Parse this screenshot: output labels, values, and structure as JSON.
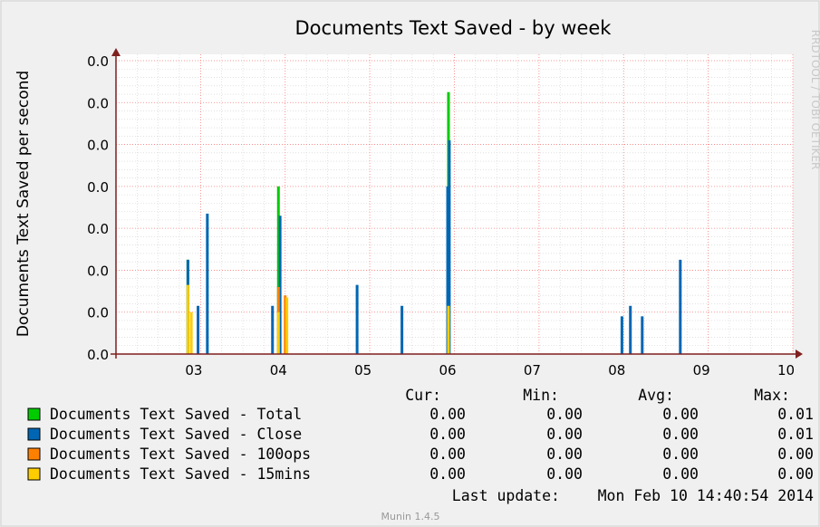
{
  "watermark": "RRDTOOL / TOBI OETIKER",
  "footer": "Munin 1.4.5",
  "colors": {
    "total": "#00cc00",
    "close": "#0066b3",
    "100ops": "#ff8000",
    "15mins": "#ffcc00",
    "grid_major": "#ff8080",
    "grid_minor": "#cfcfcf",
    "axis": "#7f1f1f",
    "canvas": "#ffffff",
    "background": "#f0f0f0"
  },
  "chart_data": {
    "type": "bar",
    "title": "Documents Text Saved - by week",
    "ylabel": "Documents Text Saved per second",
    "xlabel": "",
    "ylim": [
      0,
      0.014
    ],
    "y_tick_values": [
      0,
      0.002,
      0.004,
      0.006,
      0.008,
      0.01,
      0.012,
      0.014
    ],
    "y_tick_labels": [
      "0.0",
      "0.0",
      "0.0",
      "0.0",
      "0.0",
      "0.0",
      "0.0",
      "0.0"
    ],
    "x_tick_labels": [
      "03",
      "04",
      "05",
      "06",
      "07",
      "08",
      "09",
      "10"
    ],
    "x_tick_values": [
      2.92,
      3.92,
      4.92,
      5.92,
      6.92,
      7.92,
      8.92,
      9.92
    ],
    "xlim": [
      2.0,
      10.0
    ],
    "grid": true,
    "series": [
      {
        "name": "Documents Text Saved - Total",
        "key": "total",
        "points": [
          [
            2.85,
            0.0045
          ],
          [
            3.92,
            0.008
          ],
          [
            5.93,
            0.0125
          ]
        ]
      },
      {
        "name": "Documents Text Saved - Close",
        "key": "close",
        "points": [
          [
            2.85,
            0.0045
          ],
          [
            2.97,
            0.0023
          ],
          [
            3.08,
            0.0067
          ],
          [
            3.85,
            0.0023
          ],
          [
            3.94,
            0.0066
          ],
          [
            4.85,
            0.0033
          ],
          [
            5.38,
            0.0023
          ],
          [
            5.92,
            0.008
          ],
          [
            5.94,
            0.0102
          ],
          [
            7.98,
            0.0018
          ],
          [
            8.08,
            0.0023
          ],
          [
            8.22,
            0.0018
          ],
          [
            8.67,
            0.0045
          ]
        ]
      },
      {
        "name": "Documents Text Saved - 100ops",
        "key": "100ops",
        "points": [
          [
            3.92,
            0.0032
          ],
          [
            4.0,
            0.0028
          ]
        ]
      },
      {
        "name": "Documents Text Saved - 15mins",
        "key": "15mins",
        "points": [
          [
            2.85,
            0.0033
          ],
          [
            2.89,
            0.002
          ],
          [
            3.92,
            0.002
          ],
          [
            4.02,
            0.0027
          ],
          [
            5.93,
            0.0023
          ]
        ]
      }
    ]
  },
  "legend": {
    "headers": [
      "Cur:",
      "Min:",
      "Avg:",
      "Max:"
    ],
    "rows": [
      {
        "key": "total",
        "label": "Documents Text Saved - Total",
        "cur": "0.00",
        "min": "0.00",
        "avg": "0.00",
        "max": "0.01"
      },
      {
        "key": "close",
        "label": "Documents Text Saved - Close",
        "cur": "0.00",
        "min": "0.00",
        "avg": "0.00",
        "max": "0.01"
      },
      {
        "key": "100ops",
        "label": "Documents Text Saved - 100ops",
        "cur": "0.00",
        "min": "0.00",
        "avg": "0.00",
        "max": "0.00"
      },
      {
        "key": "15mins",
        "label": "Documents Text Saved - 15mins",
        "cur": "0.00",
        "min": "0.00",
        "avg": "0.00",
        "max": "0.00"
      }
    ],
    "last_update_label": "Last update:",
    "last_update_value": "Mon Feb 10 14:40:54 2014"
  }
}
